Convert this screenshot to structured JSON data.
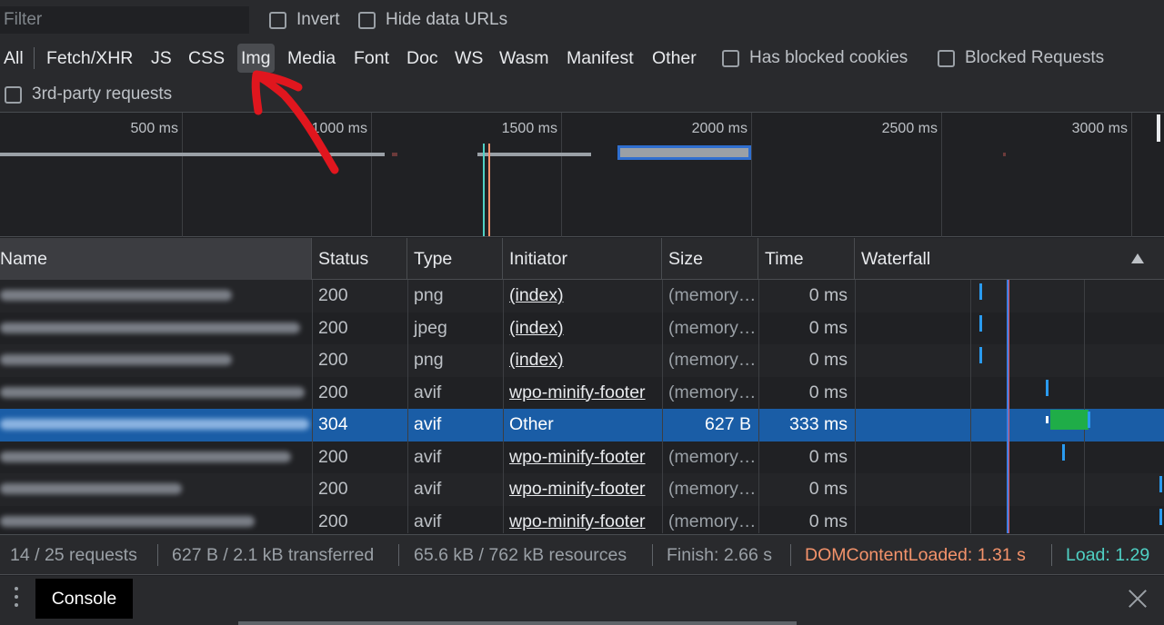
{
  "filter": {
    "placeholder": "Filter",
    "invert_label": "Invert",
    "hide_data_urls_label": "Hide data URLs"
  },
  "types": {
    "all": "All",
    "fetch": "Fetch/XHR",
    "js": "JS",
    "css": "CSS",
    "img": "Img",
    "media": "Media",
    "font": "Font",
    "doc": "Doc",
    "ws": "WS",
    "wasm": "Wasm",
    "manifest": "Manifest",
    "other": "Other",
    "active": "Img",
    "has_blocked_cookies": "Has blocked cookies",
    "blocked_requests": "Blocked Requests",
    "third_party": "3rd-party requests"
  },
  "overview": {
    "ticks": [
      "500 ms",
      "1000 ms",
      "1500 ms",
      "2000 ms",
      "2500 ms",
      "3000 ms"
    ]
  },
  "columns": {
    "name": "Name",
    "status": "Status",
    "type": "Type",
    "initiator": "Initiator",
    "size": "Size",
    "time": "Time",
    "waterfall": "Waterfall"
  },
  "rows": [
    {
      "status": "200",
      "type": "png",
      "initiator": "(index)",
      "size": "(memory cache)",
      "time": "0 ms"
    },
    {
      "status": "200",
      "type": "jpeg",
      "initiator": "(index)",
      "size": "(memory cache)",
      "time": "0 ms"
    },
    {
      "status": "200",
      "type": "png",
      "initiator": "(index)",
      "size": "(memory cache)",
      "time": "0 ms"
    },
    {
      "status": "200",
      "type": "avif",
      "initiator": "wpo-minify-footer",
      "size": "(memory cache)",
      "time": "0 ms"
    },
    {
      "status": "304",
      "type": "avif",
      "initiator": "Other",
      "size": "627 B",
      "time": "333 ms"
    },
    {
      "status": "200",
      "type": "avif",
      "initiator": "wpo-minify-footer",
      "size": "(memory cache)",
      "time": "0 ms"
    },
    {
      "status": "200",
      "type": "avif",
      "initiator": "wpo-minify-footer",
      "size": "(memory cache)",
      "time": "0 ms"
    },
    {
      "status": "200",
      "type": "avif",
      "initiator": "wpo-minify-footer",
      "size": "(memory cache)",
      "time": "0 ms"
    }
  ],
  "status_bar": {
    "requests": "14 / 25 requests",
    "transferred": "627 B / 2.1 kB transferred",
    "resources": "65.6 kB / 762 kB resources",
    "finish": "Finish: 2.66 s",
    "dom_content_loaded": "DOMContentLoaded: 1.31 s",
    "load": "Load: 1.29"
  },
  "drawer": {
    "console_tab": "Console"
  },
  "colors": {
    "selected_row": "#1a5da6",
    "dom_content_loaded": "#f4936b",
    "load": "#4fd1c5",
    "waterfall_bar": "#1fad48",
    "annotation_arrow": "#e0161e"
  }
}
